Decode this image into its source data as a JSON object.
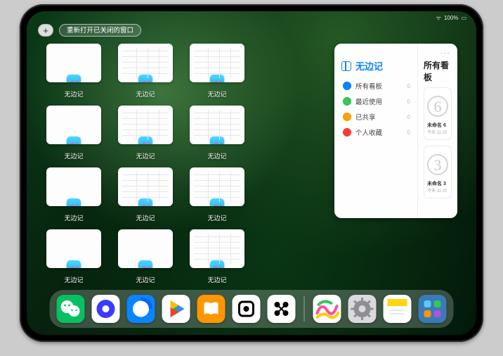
{
  "status": {
    "wifi": "●●●",
    "battery": "100%"
  },
  "topbar": {
    "plus_label": "+",
    "pill_label": "重新打开已关闭的窗口"
  },
  "win_label": "无边记",
  "windows": [
    {
      "variant": "blank"
    },
    {
      "variant": "cal"
    },
    {
      "variant": "cal"
    },
    {
      "variant": "blank"
    },
    {
      "variant": "cal"
    },
    {
      "variant": "cal"
    },
    {
      "variant": "blank"
    },
    {
      "variant": "cal"
    },
    {
      "variant": "cal"
    },
    {
      "variant": "blank"
    },
    {
      "variant": "blank"
    },
    {
      "variant": "cal"
    }
  ],
  "panel": {
    "more": "···",
    "title": "无边记",
    "items": [
      {
        "label": "所有看板",
        "count": "0",
        "color": "#0a84ff"
      },
      {
        "label": "最近使用",
        "count": "0",
        "color": "#34c759"
      },
      {
        "label": "已共享",
        "count": "0",
        "color": "#ff9f0a"
      },
      {
        "label": "个人收藏",
        "count": "0",
        "color": "#ff3b30"
      }
    ],
    "right_title": "所有看板",
    "cards": [
      {
        "glyph": "6",
        "title": "未命名 6",
        "sub": "今天 11:25"
      },
      {
        "glyph": "3",
        "title": "未命名 3",
        "sub": "今天 11:20"
      }
    ]
  },
  "dock": [
    {
      "name": "wechat",
      "bg": "#07c160"
    },
    {
      "name": "quark",
      "bg": "#ffffff"
    },
    {
      "name": "qqbrowser",
      "bg": "#0a84ff"
    },
    {
      "name": "playstore",
      "bg": "#ffffff"
    },
    {
      "name": "books",
      "bg": "#ff9500"
    },
    {
      "name": "inshot",
      "bg": "#ffffff"
    },
    {
      "name": "app-black",
      "bg": "#ffffff"
    },
    {
      "name": "freeform",
      "bg": "#ffffff"
    },
    {
      "name": "settings",
      "bg": "#d9d9de"
    },
    {
      "name": "notes",
      "bg": "#ffffff"
    },
    {
      "name": "app-library",
      "bg": "#3a7ab8"
    }
  ]
}
